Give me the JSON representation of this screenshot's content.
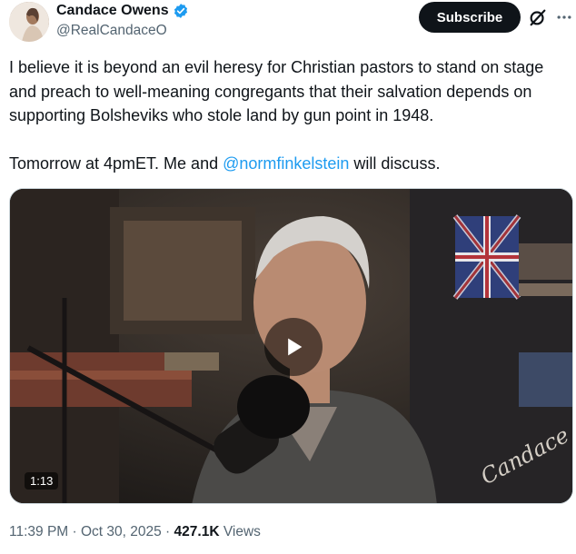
{
  "author": {
    "display_name": "Candace Owens",
    "handle": "@RealCandaceO",
    "verified_color": "#1d9bf0"
  },
  "actions": {
    "subscribe_label": "Subscribe",
    "grok_icon": "grok-icon",
    "more_icon": "more-options-icon"
  },
  "post": {
    "paragraph1": "I believe it is beyond an evil heresy for Christian pastors to stand on stage and preach to well-meaning congregants that their salvation depends on supporting Bolsheviks who stole land by gun point in 1948.",
    "paragraph2_before": "Tomorrow at 4pmET. Me and ",
    "mention": "@normfinkelstein",
    "paragraph2_after": " will discuss."
  },
  "media": {
    "duration": "1:13",
    "watermark": "Candace",
    "play_icon": "play-icon"
  },
  "meta": {
    "time": "11:39 PM",
    "separator": " · ",
    "date": "Oct 30, 2025",
    "views_count": "427.1K",
    "views_label": "Views"
  }
}
